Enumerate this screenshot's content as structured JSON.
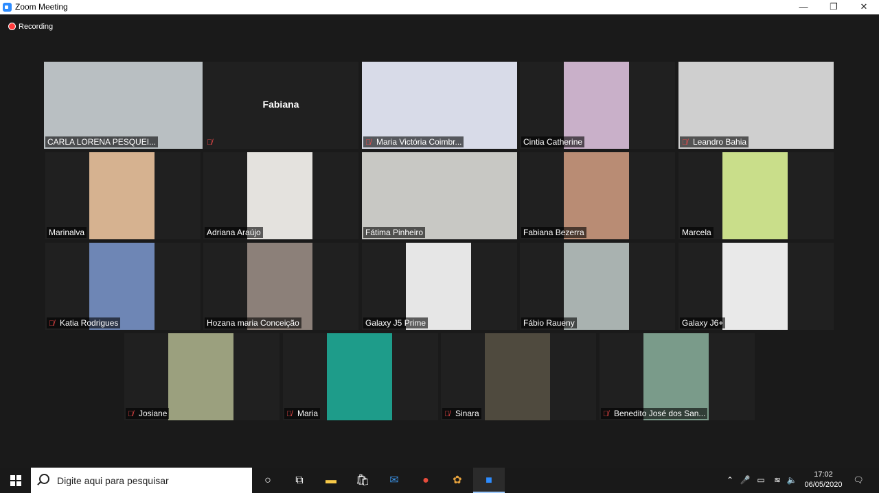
{
  "window": {
    "title": "Zoom Meeting",
    "minimize": "—",
    "maximize": "❐",
    "close": "✕"
  },
  "recording": {
    "label": "Recording"
  },
  "participants": [
    {
      "name": "CARLA LORENA PESQUEI...",
      "muted": false,
      "active": true,
      "video": true,
      "bg": "#b9bfc2"
    },
    {
      "name": "",
      "center": "Fabiana",
      "muted": true,
      "active": false,
      "video": false
    },
    {
      "name": "Maria Victória Coimbr...",
      "muted": true,
      "active": false,
      "video": true,
      "bg": "#d8dbe8"
    },
    {
      "name": "Cintia Catherine",
      "muted": false,
      "active": false,
      "video": true,
      "bg": "#c9b0c9"
    },
    {
      "name": "Leandro Bahia",
      "muted": true,
      "active": false,
      "video": true,
      "bg": "#cfcfcf"
    },
    {
      "name": "Marinalva",
      "muted": false,
      "active": false,
      "video": true,
      "bg": "#d6b290"
    },
    {
      "name": "Adriana Araújo",
      "muted": false,
      "active": false,
      "video": true,
      "bg": "#e4e2de"
    },
    {
      "name": "Fátima Pinheiro",
      "muted": false,
      "active": false,
      "video": true,
      "bg": "#c8c8c4"
    },
    {
      "name": "Fabiana Bezerra",
      "muted": false,
      "active": false,
      "video": true,
      "bg": "#b98c74"
    },
    {
      "name": "Marcela",
      "muted": false,
      "active": false,
      "video": true,
      "bg": "#c9de8a"
    },
    {
      "name": "Katia Rodrigues",
      "muted": true,
      "active": false,
      "video": true,
      "bg": "#6e86b5"
    },
    {
      "name": "Hozana maria Conceição",
      "muted": false,
      "active": false,
      "video": true,
      "bg": "#8c8079"
    },
    {
      "name": "Galaxy J5 Prime",
      "muted": false,
      "active": false,
      "video": true,
      "bg": "#e6e6e6"
    },
    {
      "name": "Fábio Raueny",
      "muted": false,
      "active": false,
      "video": true,
      "bg": "#a9b2b0"
    },
    {
      "name": "Galaxy J6+",
      "muted": false,
      "active": false,
      "video": true,
      "bg": "#e9e9e9"
    },
    {
      "name": "Josiane",
      "muted": true,
      "active": false,
      "video": true,
      "bg": "#9ba07e"
    },
    {
      "name": "Maria",
      "muted": true,
      "active": false,
      "video": true,
      "bg": "#1e9c8a"
    },
    {
      "name": "Sinara",
      "muted": true,
      "active": false,
      "video": true,
      "bg": "#4f4a3e"
    },
    {
      "name": "Benedito José dos San...",
      "muted": true,
      "active": false,
      "video": true,
      "bg": "#7a9b8a"
    }
  ],
  "taskbar": {
    "search_placeholder": "Digite aqui para pesquisar",
    "time": "17:02",
    "date": "06/05/2020",
    "icons": [
      "cortana-icon",
      "task-view-icon",
      "file-explorer-icon",
      "store-icon",
      "mail-icon",
      "chrome-icon",
      "app-icon",
      "zoom-icon"
    ]
  },
  "colors": {
    "accent": "#e5e05a",
    "muted_red": "#ff4c4c",
    "zoom_blue": "#2d8cff"
  }
}
